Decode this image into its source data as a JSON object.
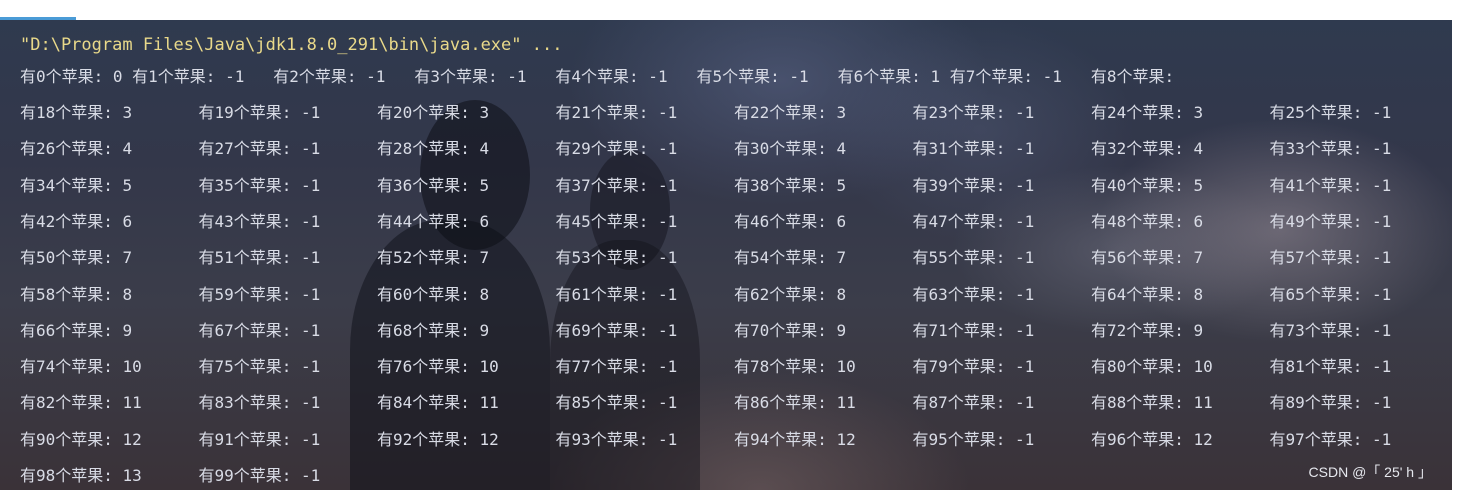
{
  "console": {
    "command": "\"D:\\Program Files\\Java\\jdk1.8.0_291\\bin\\java.exe\" ...",
    "first_line": [
      "有0个苹果: 0",
      "有1个苹果: -1",
      "有2个苹果: -1",
      "有3个苹果: -1",
      "有4个苹果: -1",
      "有5个苹果: -1",
      "有6个苹果: 1",
      "有7个苹果: -1",
      "有8个苹果:"
    ],
    "lines": [
      [
        "有18个苹果: 3",
        "有19个苹果: -1",
        "有20个苹果: 3",
        "有21个苹果: -1",
        "有22个苹果: 3",
        "有23个苹果: -1",
        "有24个苹果: 3",
        "有25个苹果: -1"
      ],
      [
        "有26个苹果: 4",
        "有27个苹果: -1",
        "有28个苹果: 4",
        "有29个苹果: -1",
        "有30个苹果: 4",
        "有31个苹果: -1",
        "有32个苹果: 4",
        "有33个苹果: -1"
      ],
      [
        "有34个苹果: 5",
        "有35个苹果: -1",
        "有36个苹果: 5",
        "有37个苹果: -1",
        "有38个苹果: 5",
        "有39个苹果: -1",
        "有40个苹果: 5",
        "有41个苹果: -1"
      ],
      [
        "有42个苹果: 6",
        "有43个苹果: -1",
        "有44个苹果: 6",
        "有45个苹果: -1",
        "有46个苹果: 6",
        "有47个苹果: -1",
        "有48个苹果: 6",
        "有49个苹果: -1"
      ],
      [
        "有50个苹果: 7",
        "有51个苹果: -1",
        "有52个苹果: 7",
        "有53个苹果: -1",
        "有54个苹果: 7",
        "有55个苹果: -1",
        "有56个苹果: 7",
        "有57个苹果: -1"
      ],
      [
        "有58个苹果: 8",
        "有59个苹果: -1",
        "有60个苹果: 8",
        "有61个苹果: -1",
        "有62个苹果: 8",
        "有63个苹果: -1",
        "有64个苹果: 8",
        "有65个苹果: -1"
      ],
      [
        "有66个苹果: 9",
        "有67个苹果: -1",
        "有68个苹果: 9",
        "有69个苹果: -1",
        "有70个苹果: 9",
        "有71个苹果: -1",
        "有72个苹果: 9",
        "有73个苹果: -1"
      ],
      [
        "有74个苹果: 10",
        "有75个苹果: -1",
        "有76个苹果: 10",
        "有77个苹果: -1",
        "有78个苹果: 10",
        "有79个苹果: -1",
        "有80个苹果: 10",
        "有81个苹果: -1"
      ],
      [
        "有82个苹果: 11",
        "有83个苹果: -1",
        "有84个苹果: 11",
        "有85个苹果: -1",
        "有86个苹果: 11",
        "有87个苹果: -1",
        "有88个苹果: 11",
        "有89个苹果: -1"
      ],
      [
        "有90个苹果: 12",
        "有91个苹果: -1",
        "有92个苹果: 12",
        "有93个苹果: -1",
        "有94个苹果: 12",
        "有95个苹果: -1",
        "有96个苹果: 12",
        "有97个苹果: -1"
      ],
      [
        "有98个苹果: 13",
        "有99个苹果: -1"
      ]
    ]
  },
  "watermark": "CSDN @「 25' h 」",
  "colors": {
    "command_text": "#e9d98a",
    "output_text": "#d9dce6",
    "accent": "#4a9bd6"
  }
}
